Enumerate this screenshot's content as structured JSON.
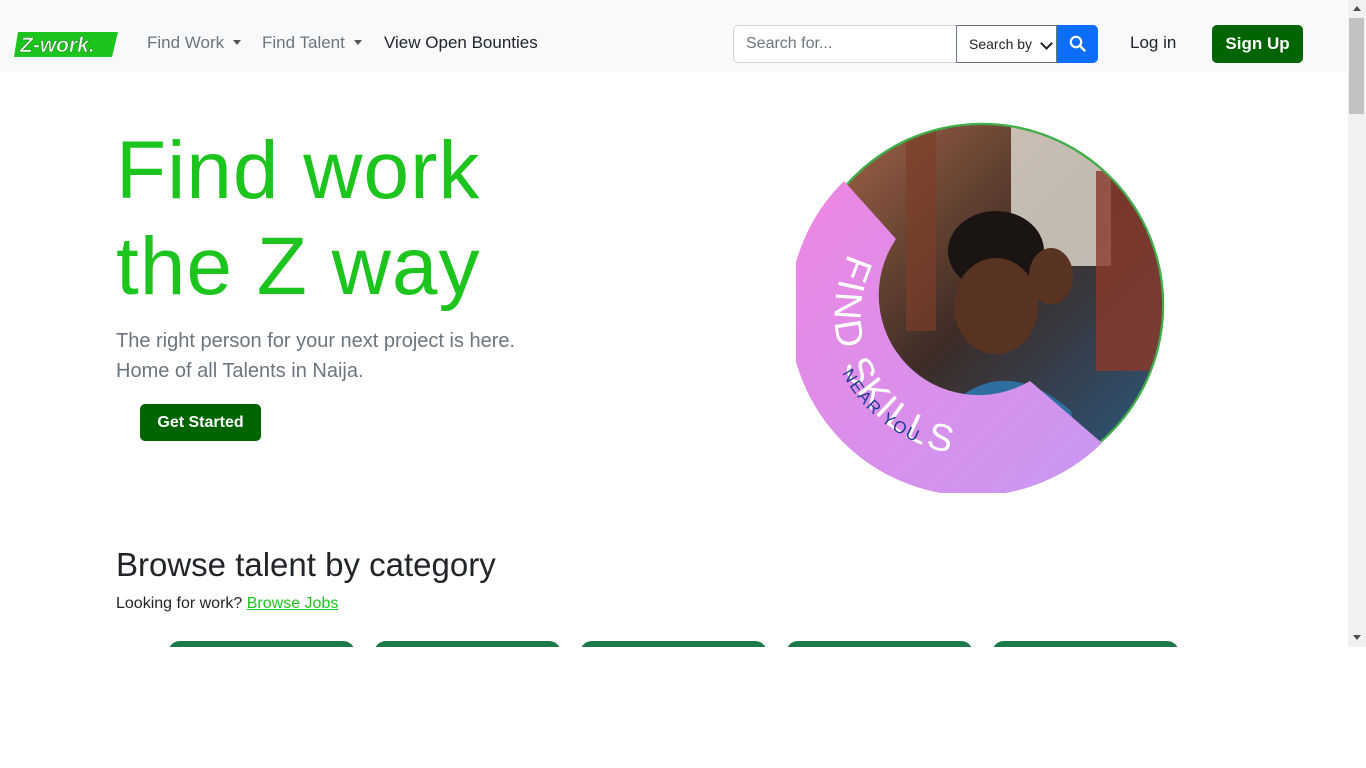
{
  "navbar": {
    "logo_text": "Z-work.",
    "find_work": "Find Work",
    "find_talent": "Find Talent",
    "open_bounties": "View Open Bounties",
    "search_placeholder": "Search for...",
    "search_by": "Search by",
    "login": "Log in",
    "signup": "Sign Up"
  },
  "hero": {
    "title_line1": "Find work",
    "title_line2": "the Z way",
    "subtitle_line1": "The right person for your next project is here.",
    "subtitle_line2": "Home of all Talents in Naija.",
    "cta": "Get Started",
    "graphic_text": "FIND SKILLS",
    "graphic_subtext": "NEAR YOU"
  },
  "browse": {
    "title": "Browse talent by category",
    "prompt": "Looking for work?",
    "link": "Browse Jobs"
  },
  "colors": {
    "brand_green": "#1ec41e",
    "dark_green": "#006400",
    "search_blue": "#0d6efd",
    "card_green": "#1c7a4a"
  },
  "icons": [
    "search-icon",
    "chevron-down-icon"
  ]
}
